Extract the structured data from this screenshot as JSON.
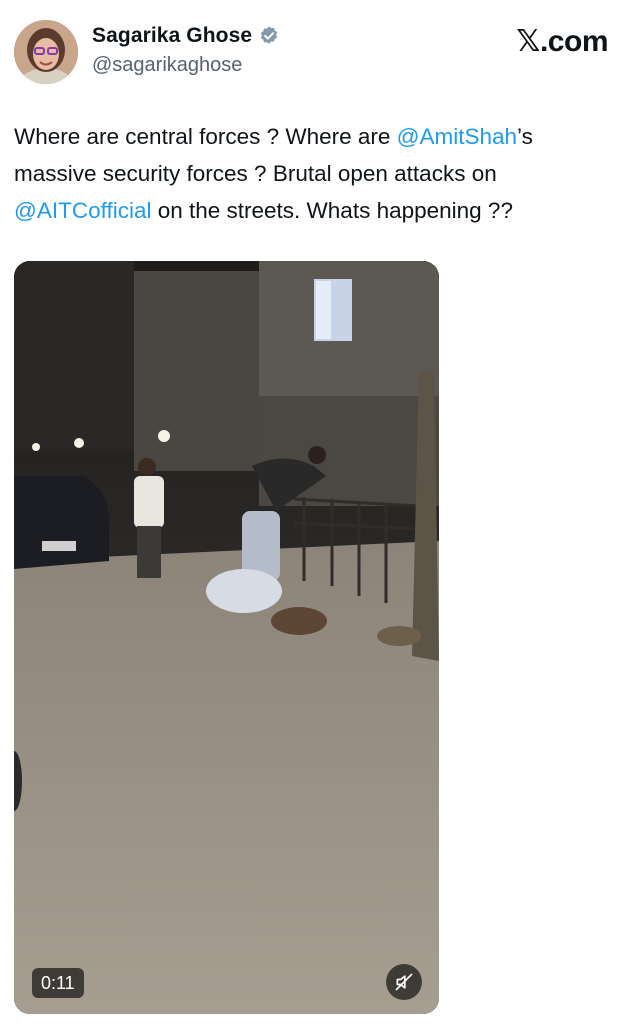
{
  "author": {
    "name": "Sagarika Ghose",
    "handle": "@sagarikaghose",
    "verified": true,
    "avatar_icon": "profile-photo"
  },
  "brand": {
    "label": "X.com",
    "icon": "x-logo"
  },
  "tweet": {
    "segments": [
      {
        "type": "text",
        "text": "Where are central forces ? Where are "
      },
      {
        "type": "mention",
        "text": "@AmitShah"
      },
      {
        "type": "text",
        "text": "’s massive security forces ? Brutal open attacks on "
      },
      {
        "type": "mention",
        "text": "@AITCofficial"
      },
      {
        "type": "text",
        "text": " on the streets. Whats happening ??"
      }
    ]
  },
  "video": {
    "duration": "0:11",
    "mute_icon": "speaker-muted-icon",
    "description_icon": "video-thumbnail"
  },
  "colors": {
    "mention": "#1d9bf0",
    "text": "#0f1419",
    "secondary": "#536471",
    "verified": "#829aab"
  }
}
